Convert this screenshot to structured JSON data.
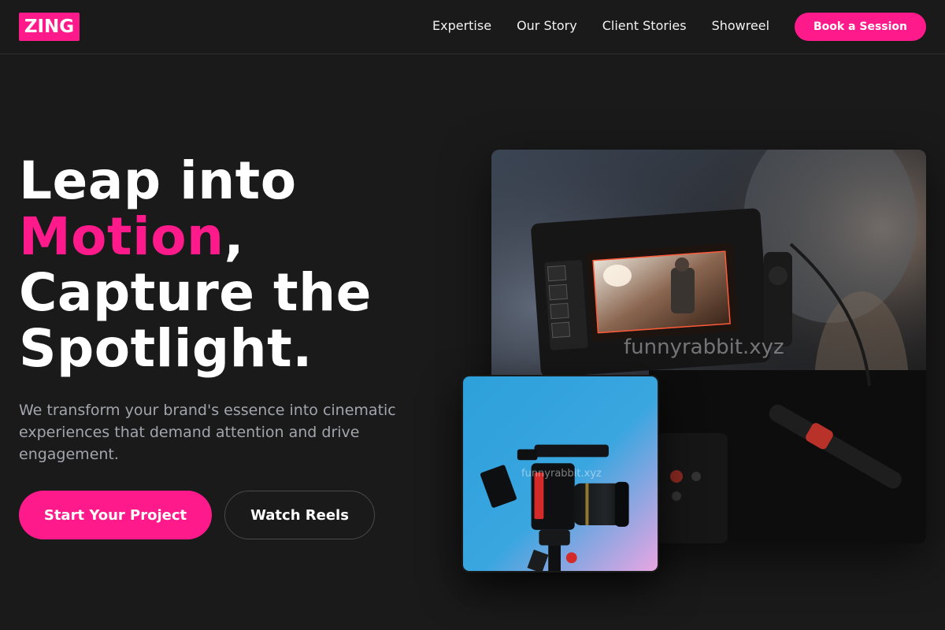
{
  "brand": {
    "logo": "ZING",
    "accent_color": "#ff1a8c"
  },
  "nav": {
    "links": [
      "Expertise",
      "Our Story",
      "Client Stories",
      "Showreel"
    ],
    "cta": "Book a Session"
  },
  "hero": {
    "headline_line1": "Leap into",
    "headline_accent": "Motion",
    "headline_comma": ",",
    "headline_line3": "Capture the",
    "headline_line4": "Spotlight.",
    "subtext": "We transform your brand's essence into cinematic experiences that demand attention and drive engagement.",
    "primary_button": "Start Your Project",
    "secondary_button": "Watch Reels"
  },
  "images": {
    "main_image": "camera-monitor-photo",
    "small_image": "camera-on-tripod-photo",
    "watermark": "funnyrabbit.xyz"
  }
}
